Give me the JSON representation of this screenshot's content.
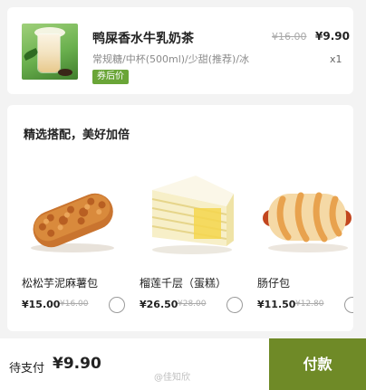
{
  "order": {
    "product_name": "鸭屎香水牛乳奶茶",
    "spec": "常规糖/中杯(500ml)/少甜(推荐)/冰",
    "coupon_tag": "券后价",
    "old_price": "¥16.00",
    "new_price": "¥9.90",
    "quantity": "x1"
  },
  "addons": {
    "title": "精选搭配，美好加倍",
    "items": [
      {
        "name": "松松芋泥麻薯包",
        "price": "¥15.00",
        "old_price": "¥16.00",
        "image": "pork-floss-bread"
      },
      {
        "name": "榴莲千层（蛋糕）",
        "price": "¥26.50",
        "old_price": "¥28.00",
        "image": "durian-crepe-cake"
      },
      {
        "name": "肠仔包",
        "price": "¥11.50",
        "old_price": "¥12.80",
        "image": "sausage-bun"
      }
    ]
  },
  "footer": {
    "pay_label": "待支付",
    "pay_amount": "¥9.90",
    "pay_button": "付款",
    "watermark": "@佳知欣"
  },
  "colors": {
    "coupon_green": "#6aa537",
    "pay_button_green": "#6f8a27",
    "background": "#f3f3f3"
  }
}
